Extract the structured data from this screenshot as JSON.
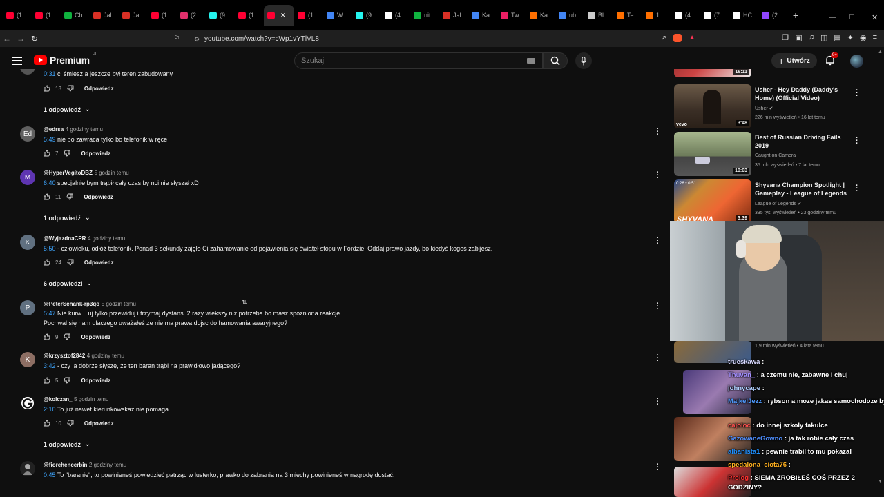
{
  "browser": {
    "tabs": [
      {
        "label": "(1",
        "color": "#ff0033"
      },
      {
        "label": "(1",
        "color": "#ff0033"
      },
      {
        "label": "Ch",
        "color": "#10b33f"
      },
      {
        "label": "Jal",
        "color": "#d93025"
      },
      {
        "label": "Jal",
        "color": "#d93025"
      },
      {
        "label": "(1",
        "color": "#ff0033"
      },
      {
        "label": "(2",
        "color": "#e1306c"
      },
      {
        "label": "(9",
        "color": "#25f4ee"
      },
      {
        "label": "(1",
        "color": "#ff0033"
      },
      {
        "label": "",
        "color": "#ff0033"
      },
      {
        "label": "(1",
        "color": "#ff0033"
      },
      {
        "label": "W",
        "color": "#4285f4"
      },
      {
        "label": "(9",
        "color": "#25f4ee"
      },
      {
        "label": "(4",
        "color": "#ffffff"
      },
      {
        "label": "nit",
        "color": "#10b33f"
      },
      {
        "label": "Jal",
        "color": "#d93025"
      },
      {
        "label": "Ka",
        "color": "#4285f4"
      },
      {
        "label": "Tw",
        "color": "#e91e63"
      },
      {
        "label": "Ka",
        "color": "#ff6f00"
      },
      {
        "label": "ub",
        "color": "#4285f4"
      },
      {
        "label": "Bl",
        "color": "#cccccc"
      },
      {
        "label": "Te",
        "color": "#ff6f00"
      },
      {
        "label": "1",
        "color": "#ff6f00"
      },
      {
        "label": "(4",
        "color": "#ffffff"
      },
      {
        "label": "(7",
        "color": "#ffffff"
      },
      {
        "label": "HC",
        "color": "#ffffff"
      },
      {
        "label": "(2",
        "color": "#9146ff"
      }
    ],
    "url": "youtube.com/watch?v=cWp1vYTlVL8"
  },
  "header": {
    "logo_word": "Premium",
    "logo_region": "PL",
    "search_placeholder": "Szukaj",
    "create_label": "Utwórz",
    "notif_badge": "9+"
  },
  "comments": [
    {
      "partial_text": "ci śmiesz a jeszcze był teren zabudowany",
      "ts": "0:31",
      "likes": "13",
      "reply_label": "Odpowiedz",
      "replies_label": "1 odpowiedź"
    },
    {
      "handle": "@edrsa",
      "ago": "4 godziny temu",
      "ts": "5:49",
      "text": "nie bo zawraca tylko bo telefonik w ręce",
      "likes": "7",
      "avatar_letter": "Ed",
      "reply_label": "Odpowiedz"
    },
    {
      "handle": "@HyperVegitoDBZ",
      "ago": "5 godzin temu",
      "ts": "6:40",
      "text": "specjalnie bym trąbił cały czas by nci nie słyszał xD",
      "likes": "11",
      "avatar_letter": "M",
      "reply_label": "Odpowiedz",
      "replies_label": "1 odpowiedź"
    },
    {
      "handle": "@WyjazdnaCPR",
      "ago": "4 godziny temu",
      "ts": "5:50",
      "text": "- człowieku, odłóż telefonik. Ponad 3 sekundy zajęło Ci zahamowanie od pojawienia się świateł stopu w Fordzie. Oddaj prawo jazdy, bo kiedyś kogoś zabijesz.",
      "likes": "24",
      "avatar_letter": "K",
      "reply_label": "Odpowiedz",
      "replies_label": "6 odpowiedzi"
    },
    {
      "handle": "@PeterSchank-rp3qo",
      "ago": "5 godzin temu",
      "ts": "5:47",
      "text": "Nie kurw....uj tylko przewiduj i trzymaj dystans. 2 razy wiekszy niz potrzeba bo masz spozniona reakcje.",
      "text2": "Pochwal się nam dlaczego uważałeś ze nie ma prawa dojsc do hamowania awaryjnego?",
      "likes": "9",
      "avatar_letter": "P",
      "reply_label": "Odpowiedz"
    },
    {
      "handle": "@krzysztof2842",
      "ago": "4 godziny temu",
      "ts": "3:42",
      "text": "- czy ja dobrze słyszę, że ten baran trąbi na prawidłowo jadącego?",
      "likes": "5",
      "avatar_letter": "K",
      "reply_label": "Odpowiedz"
    },
    {
      "handle": "@kolczan_",
      "ago": "5 godzin temu",
      "ts": "2:10",
      "text": "To już nawet kierunkowskaz nie pomaga...",
      "likes": "10",
      "reply_label": "Odpowiedz",
      "replies_label": "1 odpowiedź"
    },
    {
      "handle": "@fiorehencerbin",
      "ago": "2 godziny temu",
      "ts": "0:45",
      "text": "To \"baranie\", to powinieneś powiedzieć patrząc w lusterko, prawko do zabrania na 3 miechy powinieneś w nagrodę dostać.",
      "reply_label": "Odpowiedz"
    }
  ],
  "sidebar": {
    "videos": [
      {
        "title": "",
        "channel": "",
        "meta": "",
        "duration": "16:11"
      },
      {
        "title": "Usher - Hey Daddy (Daddy's Home) (Official Video)",
        "channel": "Usher",
        "meta": "226 mln wyświetleń • 16 lat temu",
        "duration": "3:48",
        "badge": "vevo"
      },
      {
        "title": "Best of Russian Driving Fails 2019",
        "channel": "Caught on Camera",
        "meta": "35 mln wyświetleń • 7 lat temu",
        "duration": "10:03"
      },
      {
        "title": "Shyvana Champion Spotlight | Gameplay - League of Legends",
        "channel": "League of Legends",
        "meta": "335 tys. wyświetleń • 23 godziny temu",
        "duration": "3:39",
        "thumb_label": "SHYVANA",
        "thumb_tag": "0:26 • 0:51"
      }
    ],
    "partial_meta": "1,9 mln wyświetleń • 4 lata temu"
  },
  "chat": [
    {
      "user": "trueskawa",
      "msg": ""
    },
    {
      "user": "Thuvan_",
      "msg": "a czemu nie, zabawne i chuj"
    },
    {
      "user": "johnycape",
      "msg": ""
    },
    {
      "user": "MajkelJezz",
      "msg": "rybson",
      "msg2": "a moze jakas samochodoze bys obejrzal?"
    },
    {
      "user": "cajoloc",
      "msg": "do innej szkoly fakulce"
    },
    {
      "user": "GazowaneGowno",
      "msg": "ja tak robie cały czas"
    },
    {
      "user": "albanista1",
      "msg": "pewnie trabil to mu pokazal"
    },
    {
      "user": "spedalona_ciota76",
      "msg": ""
    },
    {
      "user": "Prolog",
      "msg": "SIEMA ZROBIŁEŚ COŚ PRZEZ 2 GODZINY?"
    }
  ],
  "colors": {
    "accent": "#ff0000",
    "link": "#3ea6ff",
    "bg": "#0f0f0f"
  }
}
